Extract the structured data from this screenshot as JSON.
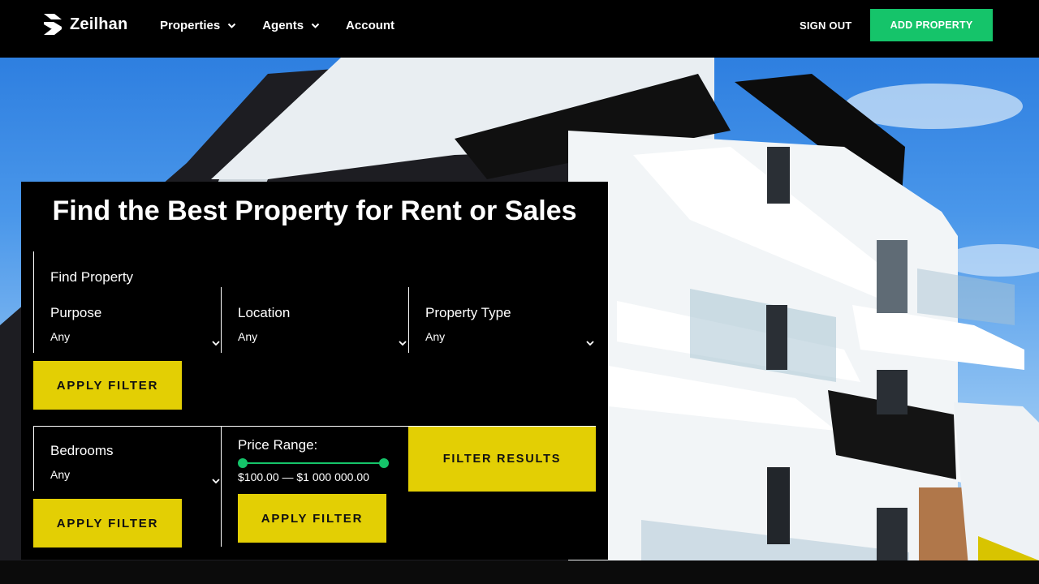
{
  "header": {
    "logo_text": "Zeilhan",
    "nav": [
      {
        "label": "Properties",
        "has_dropdown": true
      },
      {
        "label": "Agents",
        "has_dropdown": true
      },
      {
        "label": "Account",
        "has_dropdown": false
      }
    ],
    "sign_out": "SIGN OUT",
    "add_property": "ADD PROPERTY"
  },
  "search": {
    "title": "Find the Best Property for Rent or Sales",
    "find_label": "Find Property",
    "purpose": {
      "label": "Purpose",
      "value": "Any"
    },
    "location": {
      "label": "Location",
      "value": "Any"
    },
    "property_type": {
      "label": "Property Type",
      "value": "Any"
    },
    "bedrooms": {
      "label": "Bedrooms",
      "value": "Any"
    },
    "apply_filter": "APPLY FILTER",
    "price_label": "Price Range:",
    "price_range": "$100.00 — $1 000 000.00",
    "price_min_fraction": 0,
    "price_max_fraction": 1,
    "filter_results": "FILTER RESULTS"
  },
  "colors": {
    "accent_green": "#15c46a",
    "accent_yellow": "#e3cf04",
    "background": "#000000"
  }
}
